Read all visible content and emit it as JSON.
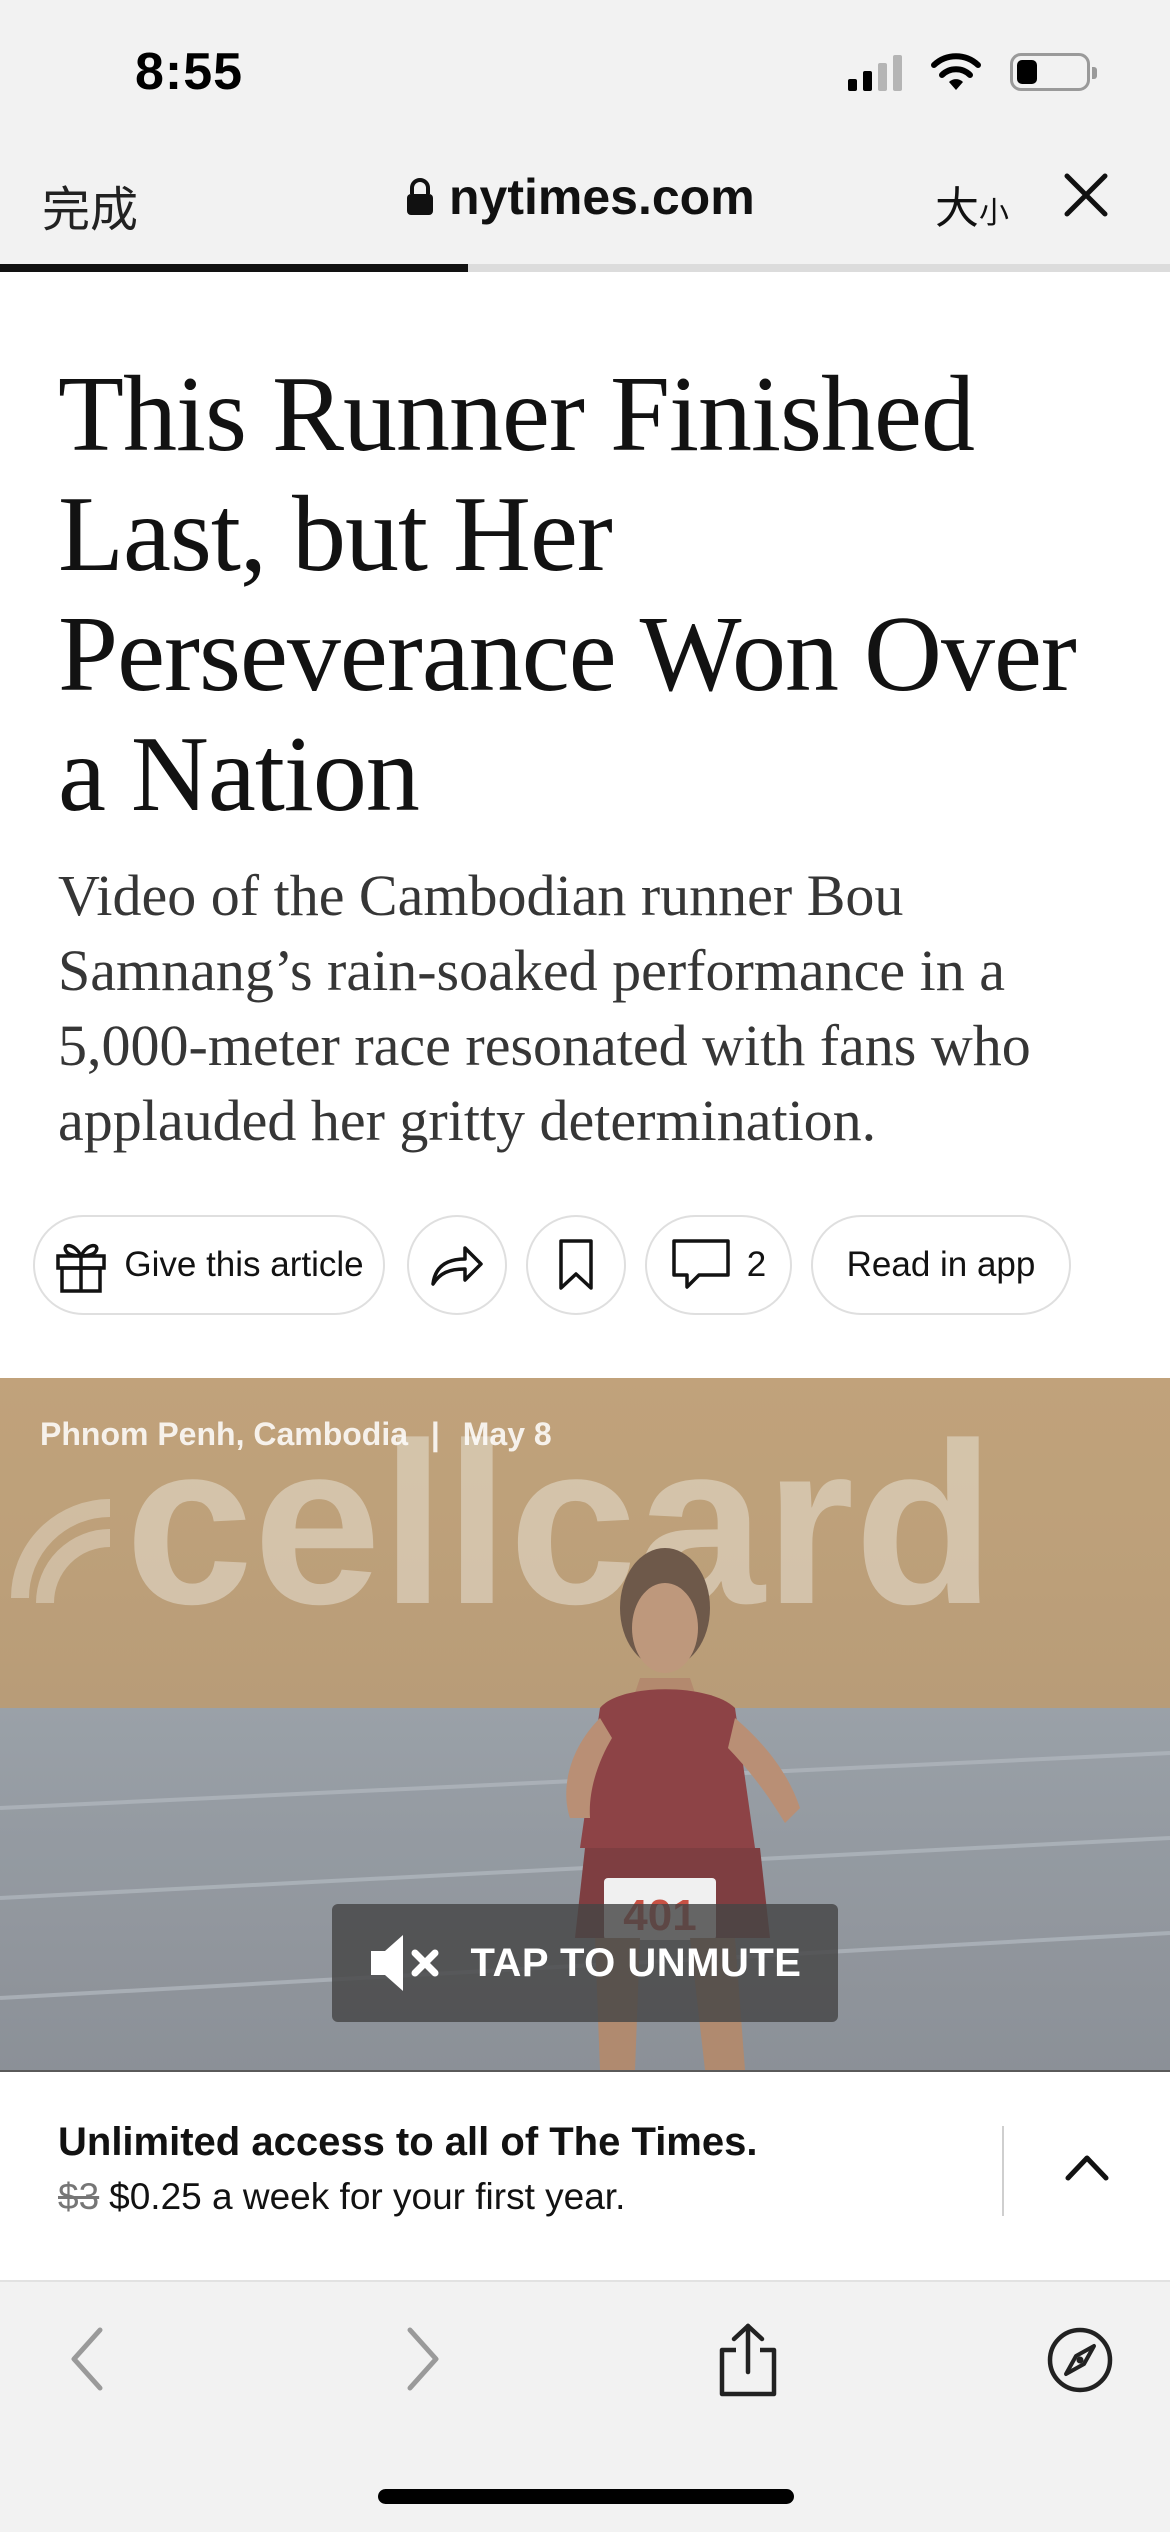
{
  "status_bar": {
    "time": "8:55",
    "icons": [
      "cellular-signal-icon",
      "wifi-icon",
      "battery-icon"
    ]
  },
  "browser": {
    "done_label": "完成",
    "url": "nytimes.com",
    "text_size_label_big": "大",
    "text_size_label_small": "小",
    "page_load_progress": 0.4,
    "icons": [
      "lock-icon",
      "close-icon"
    ]
  },
  "article": {
    "headline": "This Runner Finished Last, but Her Perseverance Won Over a Nation",
    "summary": "Video of the Cambodian runner Bou Samnang’s rain-soaked performance in a 5,000-meter race resonated with fans who applauded her gritty determination."
  },
  "actions": {
    "gift_label": "Give this article",
    "comments_count": "2",
    "read_in_app_label": "Read in app",
    "icons": [
      "gift-icon",
      "share-icon",
      "bookmark-icon",
      "comment-icon"
    ]
  },
  "video": {
    "location": "Phnom Penh, Cambodia",
    "separator": "|",
    "date": "May 8",
    "unmute_label": "TAP TO UNMUTE",
    "background_sign_text": "cellcard",
    "bib_number": "401",
    "icons": [
      "muted-speaker-icon"
    ]
  },
  "promo": {
    "title": "Unlimited access to all of The Times.",
    "old_price": "$3",
    "new_price": "$0.25 a week for your first year.",
    "icons": [
      "chevron-up-icon"
    ]
  },
  "bottom_toolbar": {
    "icons": [
      "back-arrow-icon",
      "forward-arrow-icon",
      "share-sheet-icon",
      "compass-icon"
    ]
  },
  "colors": {
    "chrome_background": "#f2f2f2",
    "text_primary": "#121212",
    "summary_text": "#363636",
    "video_overlay": "#464646"
  }
}
